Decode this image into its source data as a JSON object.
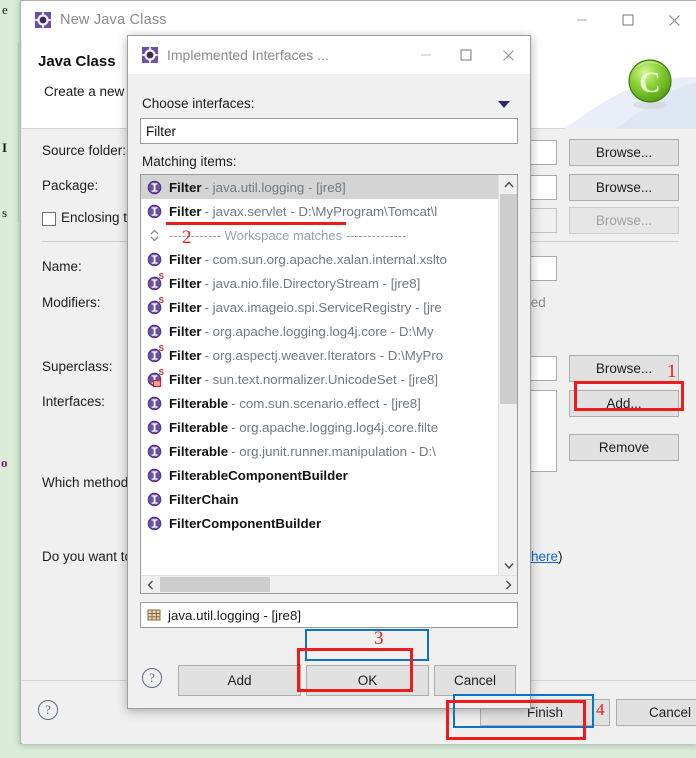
{
  "editor_background": {
    "color": "#d8ecd8",
    "left_glyphs": [
      "e",
      "I",
      "s",
      "o"
    ]
  },
  "wizard": {
    "title": "New Java Class",
    "icon": "eclipse-gear-icon",
    "titlebar_buttons": [
      {
        "name": "minimize",
        "glyph": "—"
      },
      {
        "name": "maximize",
        "glyph": "□"
      },
      {
        "name": "close",
        "glyph": "✕"
      }
    ],
    "header": {
      "title": "Java Class",
      "subtitle": "Create a new J",
      "logo": "green-c-logo"
    },
    "fields": [
      {
        "label": "Source folder:",
        "value": "",
        "button": "Browse...",
        "disabled": false
      },
      {
        "label": "Package:",
        "value": "",
        "button": "Browse...",
        "disabled": false
      },
      {
        "label": "Enclosing ty",
        "value": "",
        "button": "Browse...",
        "disabled": true,
        "checkbox": true
      }
    ],
    "name_label": "Name:",
    "modifiers_label": "Modifiers:",
    "modifiers_value": "ted",
    "superclass_label": "Superclass:",
    "superclass_button": "Browse...",
    "interfaces_label": "Interfaces:",
    "interfaces_add_button": "Add...",
    "interfaces_remove_button": "Remove",
    "which_method_label": "Which method",
    "do_you_want_label": "Do you want to",
    "here_link": "here",
    "here_suffix": ")",
    "finish_button": "Finish",
    "cancel_button": "Cancel",
    "help_icon": "question-mark-icon"
  },
  "dialog": {
    "title": "Implemented Interfaces ...",
    "icon": "eclipse-gear-icon",
    "titlebar_buttons": [
      {
        "name": "minimize",
        "glyph": "—"
      },
      {
        "name": "maximize",
        "glyph": "□"
      },
      {
        "name": "close",
        "glyph": "✕"
      }
    ],
    "choose_label": "Choose interfaces:",
    "filter_value": "Filter",
    "matching_label": "Matching items:",
    "items": [
      {
        "kind": "interface",
        "name": "Filter",
        "rest": "- java.util.logging - [jre8]",
        "selected": true,
        "static": false,
        "restricted": false
      },
      {
        "kind": "interface",
        "name": "Filter",
        "rest": "- javax.servlet - D:\\MyProgram\\Tomcat\\l",
        "selected": false,
        "static": false,
        "restricted": false,
        "underlined": true
      },
      {
        "kind": "separator",
        "name": "",
        "rest": "------------ Workspace matches --------------"
      },
      {
        "kind": "interface",
        "name": "Filter",
        "rest": "- com.sun.org.apache.xalan.internal.xslto",
        "selected": false,
        "static": false,
        "restricted": false
      },
      {
        "kind": "interface",
        "name": "Filter",
        "rest": "- java.nio.file.DirectoryStream - [jre8]",
        "selected": false,
        "static": true,
        "restricted": false
      },
      {
        "kind": "interface",
        "name": "Filter",
        "rest": "- javax.imageio.spi.ServiceRegistry - [jre",
        "selected": false,
        "static": true,
        "restricted": false
      },
      {
        "kind": "interface",
        "name": "Filter",
        "rest": "- org.apache.logging.log4j.core - D:\\My",
        "selected": false,
        "static": false,
        "restricted": false
      },
      {
        "kind": "interface",
        "name": "Filter",
        "rest": "- org.aspectj.weaver.Iterators - D:\\MyPro",
        "selected": false,
        "static": true,
        "restricted": false
      },
      {
        "kind": "interface",
        "name": "Filter",
        "rest": "- sun.text.normalizer.UnicodeSet - [jre8]",
        "selected": false,
        "static": true,
        "restricted": true
      },
      {
        "kind": "interface",
        "name": "Filter",
        "bold_part": "Filter",
        "suffix": "able",
        "rest": "- com.sun.scenario.effect - [jre8]",
        "selected": false,
        "static": false,
        "restricted": false
      },
      {
        "kind": "interface",
        "name": "Filter",
        "bold_part": "Filter",
        "suffix": "able",
        "rest": "- org.apache.logging.log4j.core.filte",
        "selected": false,
        "static": false,
        "restricted": false
      },
      {
        "kind": "interface",
        "name": "Filter",
        "bold_part": "Filter",
        "suffix": "able",
        "rest": "- org.junit.runner.manipulation - D:\\",
        "selected": false,
        "static": false,
        "restricted": false
      },
      {
        "kind": "interface",
        "name": "Filter",
        "bold_part": "Filter",
        "suffix": "ableComponentBuilder",
        "rest": "",
        "selected": false,
        "static": false,
        "restricted": false
      },
      {
        "kind": "interface",
        "name": "Filter",
        "bold_part": "Filter",
        "suffix": "Chain",
        "rest": "",
        "selected": false,
        "static": false,
        "restricted": false
      },
      {
        "kind": "interface",
        "name": "Filter",
        "bold_part": "Filter",
        "suffix": "ComponentBuilder",
        "rest": "",
        "selected": false,
        "static": false,
        "restricted": false
      }
    ],
    "selected_package": "java.util.logging - [jre8]",
    "selected_package_icon": "package-icon",
    "buttons": {
      "add": "Add",
      "ok": "OK",
      "cancel": "Cancel"
    },
    "help_icon": "question-mark-icon"
  },
  "annotations": [
    {
      "number": "1",
      "target": "wizard-add-button"
    },
    {
      "number": "2",
      "target": "filter-javax-servlet-row"
    },
    {
      "number": "3",
      "target": "dialog-ok-button"
    },
    {
      "number": "4",
      "target": "wizard-finish-button"
    }
  ],
  "colors": {
    "annotation_red": "#ee1b1b",
    "focus_blue": "#0b74c4",
    "editor_green": "#d8ecd8",
    "interface_icon": "#5c3f8f",
    "link_blue": "#1565d8"
  }
}
